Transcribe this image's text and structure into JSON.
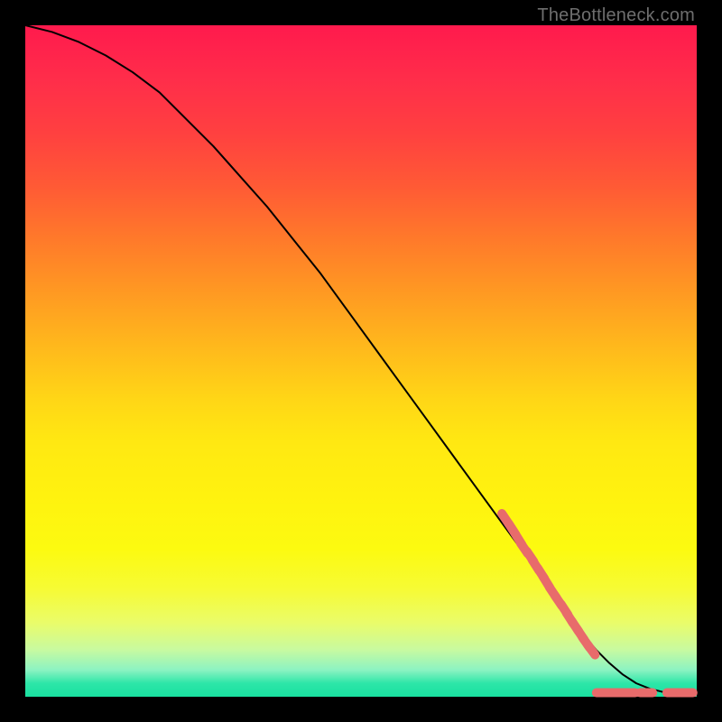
{
  "watermark": "TheBottleneck.com",
  "colors": {
    "background": "#000000",
    "curve_stroke": "#000000",
    "dot_fill": "#e86b6b",
    "dot_core": "#d85656"
  },
  "chart_data": {
    "type": "line",
    "title": "",
    "xlabel": "",
    "ylabel": "",
    "xlim": [
      0,
      100
    ],
    "ylim": [
      0,
      100
    ],
    "series": [
      {
        "name": "curve",
        "x": [
          0,
          4,
          8,
          12,
          16,
          20,
          24,
          28,
          32,
          36,
          40,
          44,
          48,
          52,
          56,
          60,
          64,
          68,
          72,
          76,
          80,
          82.5,
          85,
          87,
          89,
          91,
          93,
          95,
          97,
          99,
          100
        ],
        "y": [
          100,
          99,
          97.5,
          95.5,
          93,
          90,
          86,
          82,
          77.5,
          73,
          68,
          63,
          57.5,
          52,
          46.5,
          41,
          35.5,
          30,
          24.5,
          19,
          13.5,
          10,
          7,
          5,
          3.3,
          2,
          1.2,
          0.7,
          0.6,
          0.6,
          0.6
        ]
      }
    ],
    "dots_upper_segment": [
      {
        "x": 71.5,
        "y": 26.5
      },
      {
        "x": 72.5,
        "y": 25.0
      },
      {
        "x": 73.5,
        "y": 23.4
      },
      {
        "x": 74.3,
        "y": 22.1
      },
      {
        "x": 75.2,
        "y": 20.9
      },
      {
        "x": 76.0,
        "y": 19.6
      },
      {
        "x": 76.8,
        "y": 18.4
      },
      {
        "x": 77.6,
        "y": 17.1
      }
    ],
    "dots_lower_segment": [
      {
        "x": 78.6,
        "y": 15.5
      },
      {
        "x": 79.4,
        "y": 14.3
      },
      {
        "x": 80.3,
        "y": 13.0
      },
      {
        "x": 81.1,
        "y": 11.7
      },
      {
        "x": 81.9,
        "y": 10.5
      },
      {
        "x": 82.7,
        "y": 9.3
      },
      {
        "x": 83.5,
        "y": 8.1
      },
      {
        "x": 84.3,
        "y": 7.0
      }
    ],
    "dots_bottom_cluster": [
      {
        "x": 86.0,
        "y": 0.6
      },
      {
        "x": 87.3,
        "y": 0.6
      },
      {
        "x": 88.6,
        "y": 0.6
      },
      {
        "x": 89.9,
        "y": 0.6
      }
    ],
    "dots_bottom_mid": [
      {
        "x": 92.5,
        "y": 0.6
      }
    ],
    "dots_bottom_right": [
      {
        "x": 96.5,
        "y": 0.6
      },
      {
        "x": 98.5,
        "y": 0.6
      }
    ]
  }
}
